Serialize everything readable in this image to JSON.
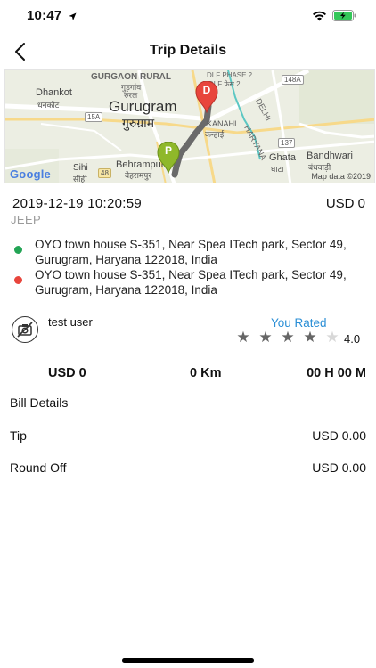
{
  "status": {
    "time": "10:47"
  },
  "nav": {
    "title": "Trip Details"
  },
  "map": {
    "labels": {
      "gurgaon_rural": "GURGAON RURAL",
      "gurgaon_rural_hi": "गुड़गांव",
      "gurgaon_rural_hi2": "रुरल",
      "dlf_phase": "DLF PHASE 2",
      "dlf_phase_hi": "DLF फेस 2",
      "dhankot": "Dhankot",
      "dhankot_hi": "धनकोट",
      "gurugram": "Gurugram",
      "gurugram_hi": "गुरुग्राम",
      "kanahi": "KANAHI",
      "kanahi_hi": "कन्हाई",
      "haryana": "HARYANA",
      "delhi": "DELHI",
      "ghata": "Ghata",
      "ghata_hi": "घाटा",
      "bandhwari": "Bandhwari",
      "bandhwari_hi": "बंधवाड़ी",
      "behrampur": "Behrampur",
      "behrampur_hi": "बेहरामपुर",
      "sihi": "Sihi",
      "sihi_hi": "सीही",
      "road_15a": "15A",
      "road_148a": "148A",
      "road_137": "137",
      "road_48": "48",
      "attribution": "Map data ©2019",
      "google": "Google"
    },
    "markers": {
      "drop": "D",
      "pickup": "P"
    }
  },
  "trip": {
    "datetime": "2019-12-19 10:20:59",
    "fare": "USD 0",
    "vehicle": "JEEP",
    "pickup_address": "OYO town house S-351, Near Spea ITech park, Sector 49, Gurugram, Haryana 122018, India",
    "drop_address": "OYO town house S-351, Near Spea ITech park, Sector 49, Gurugram, Haryana 122018, India",
    "pickup_color": "#23a455",
    "drop_color": "#e8453c"
  },
  "driver": {
    "name": "test user",
    "rated_label": "You Rated",
    "rating": "4.0",
    "stars_filled": 4,
    "stars_total": 5
  },
  "summary": {
    "amount": "USD 0",
    "distance": "0 Km",
    "duration": "00 H 00 M"
  },
  "bill": {
    "heading": "Bill Details",
    "rows": [
      {
        "label": "Tip",
        "value": "USD 0.00"
      },
      {
        "label": "Round Off",
        "value": "USD 0.00"
      }
    ]
  },
  "colors": {
    "accent": "#2b8fd6"
  }
}
